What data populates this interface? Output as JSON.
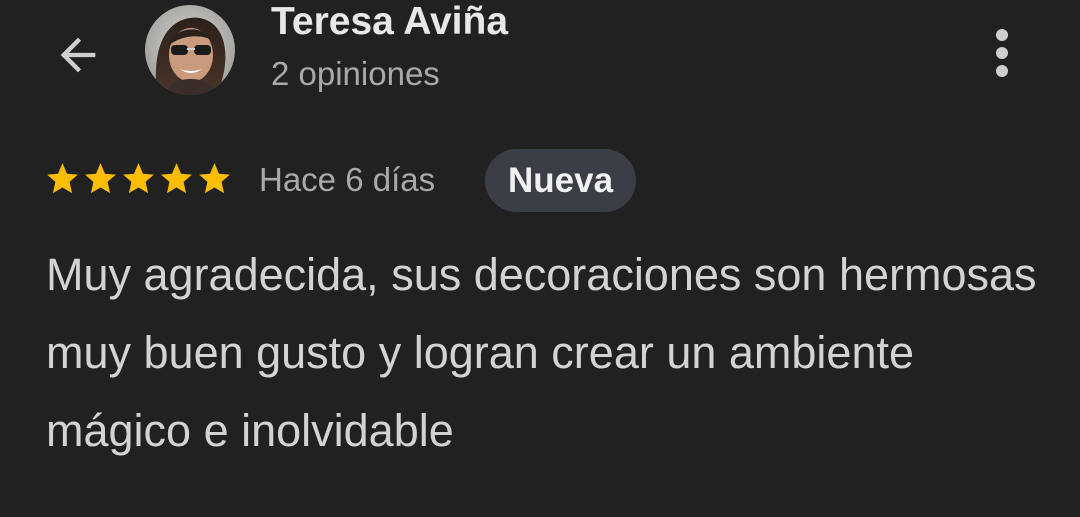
{
  "header": {
    "back_icon": "arrow-left-icon",
    "avatar_icon": "user-avatar-photo",
    "reviewer_name": "Teresa Aviña",
    "reviewer_meta": "2 opiniones",
    "more_icon": "more-vertical-icon"
  },
  "review": {
    "rating": 5,
    "rating_max": 5,
    "star_icon": "star-icon",
    "time": "Hace 6 días",
    "badge": "Nueva",
    "text": "Muy agradecida, sus decoraciones son hermosas muy buen gusto y logran crear un ambiente mágico e inolvidable"
  },
  "colors": {
    "background": "#212121",
    "star": "#fbbc04",
    "badge_bg": "#3b3e46",
    "primary_text": "#e8e8e8",
    "secondary_text": "#a9a9a9",
    "body_text": "#d3d3d3"
  }
}
